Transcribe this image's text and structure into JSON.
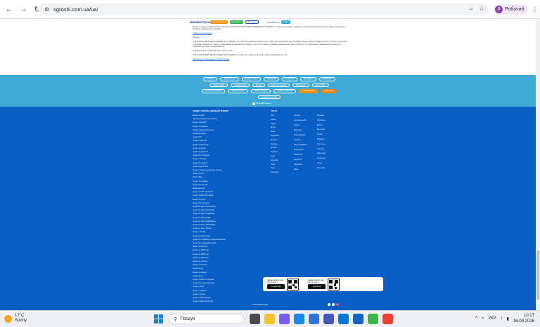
{
  "browser": {
    "url": "sgroshi.com.ua/ua/",
    "profile_label": "Робочий",
    "profile_initial": "Р"
  },
  "site_header": {
    "logo": "ШвидкоГроші",
    "buttons": [
      "Отримати кредит",
      "Продовжити",
      "Погашення"
    ],
    "phone": "0 800 806 000",
    "login": "Увійти"
  },
  "article": {
    "paragraphs": [
      "Кредити надаються фінансовою компанією ТОВ «СТРАХОВИЙ ЦЕНТР КРЕДИТНОГО СЕРВІСУ». Умови кредитування, тарифи та договори розміщено на сайті. Перед укладанням договору ознайомтесь з умовами.",
      "Правила кредитування",
      "Ліцензія: ",
      "ТОВ «СТРАХОВИЙ ЦЕНТР КРЕДИТНОГО СЕРВІСУ» м. Київ, вул. Академіка Заболотного, 148, ідентифікаційний код 37526960. Ліцензія НБУ на надання коштів у позику, в тому числі і на умовах фінансового кредиту. Інформація про фінансову установу, її послуги та умови їх надання розміщена на сайті sgroshi.com.ua. Звернення споживачів розглядаються відповідно до чинного законодавства.",
      "Інформація для споживачів щодо захисту прав.",
      "ТОВ «СТРАХОВИЙ ЦЕНТР КРЕДИТНОГО СЕРВІСУ» м. Київ, вул. Заболотного 148 e-mail: info@sgroshi.com.ua",
      "Звернення до Національного банку України"
    ]
  },
  "tags": {
    "items": [
      {
        "label": "На карту",
        "style": "plain"
      },
      {
        "label": "Кредит онлайн",
        "style": "plain"
      },
      {
        "label": "Кредит на карту",
        "style": "plain"
      },
      {
        "label": "Без відмов",
        "style": "plain"
      },
      {
        "label": "Терміново",
        "style": "plain"
      },
      {
        "label": "Без довідок",
        "style": "plain"
      },
      {
        "label": "Цілодобово",
        "style": "plain"
      },
      {
        "label": "Кредит під 0%",
        "style": "plain"
      },
      {
        "label": "Онлайн позика",
        "style": "plain"
      },
      {
        "label": "Під 1%",
        "style": "plain"
      },
      {
        "label": "Кредит без дзвінків",
        "style": "plain"
      },
      {
        "label": "Мікрокредит",
        "style": "plain"
      },
      {
        "label": "Гроші в борг",
        "style": "plain"
      },
      {
        "label": "Кредит без перевірок",
        "style": "plain"
      },
      {
        "label": "Швидкий кредит",
        "style": "plain"
      },
      {
        "label": "Кредит на картку",
        "style": "plain"
      },
      {
        "label": "Кредит до зарплати",
        "style": "plain"
      },
      {
        "label": "Позика онлайн",
        "style": "orange"
      },
      {
        "label": "Кредит 24/7",
        "style": "orange2"
      },
      {
        "label": "Кредит без застави",
        "style": "plain"
      }
    ],
    "all_tags_label": "Популярні запити"
  },
  "footer": {
    "col1_title": "КРЕДИТ ОНЛАЙН (ШВИДКИЙ КРЕДИТ)",
    "col1_links": [
      "Кредит онлайн",
      "На картку (банківську) в Україні",
      "Кредит терміново",
      "Кредит без відмови",
      "Кредит онлайн цілодобово",
      "Безпечний кредит",
      "Кредит 24/7",
      "Кредит студентам",
      "Кредит пенсіонерам",
      "Кредит на картку",
      "Кредит до зарплати",
      "Кредит без перевірок",
      "Кредит з 18 років",
      "Кредит без довідок",
      "Кредит безробітним",
      "Кредит з поганою кредитною історією",
      "Кредит під 0%",
      "Гроші в борг",
      "Кредит без дзвінків",
      "Кредит без застави",
      "Швидкий кредит",
      "Кредит онлайн на рахунок",
      "Кредит онлайн без відмов",
      "Кредит без фото",
      "Кредит без паспорта",
      "Кредит на карту Приватбанку",
      "Кредит на карту Монобанку",
      "Кредит на карту Ощадбанку",
      "Кредит на карту ПУМБ",
      "Кредит на карту Райффайзен",
      "Кредит на карту Укрсиббанку",
      "Кредит на карту А-Банку",
      "Кредит з 21 року",
      "Кредит для військових",
      "Кредит без офіційного працевлаштування",
      "Кредит без відвідування офісу",
      "Кредит на 5000 грн",
      "Кредит на 10000 грн",
      "Кредит на 20000 грн",
      "Кредит на 30000 грн",
      "Кредит на 1 місяць",
      "Кредит на 3 місяці",
      "Кредит на рік",
      "Кредит на вихідні",
      "Кредит вночі",
      "Кредит онлайн без дзвінків",
      "Кредит без кредитної історії",
      "Кредит у Києві",
      "Кредит у Харкові",
      "Кредит у Львові",
      "Кредит онлайн Україна",
      "Кредит онлайн на 30 днів"
    ],
    "col2_title": "МІСТА",
    "col2_links": [
      "Київ",
      "Харків",
      "Одеса",
      "Дніпро",
      "Львів",
      "Запоріжжя",
      "Вінниця",
      "Полтава",
      "Чернігів",
      "Черкаси",
      "Суми",
      "Житомир",
      "Рівне",
      "Луцьк",
      "Тернопіль"
    ],
    "col3_links": [
      "Ужгород",
      "Кропивницький",
      "Херсон",
      "Миколаїв",
      "Хмельницький",
      "Чернівці",
      "Івано-Франківськ",
      "Біла Церква",
      "Кременчук",
      "Кривий Ріг",
      "Маріуполь",
      "Ірпінь"
    ],
    "col4_links": [
      "Бровари",
      "Бориспіль",
      "Фастів",
      "Васильків",
      "Обухів",
      "Бердичів",
      "Коростень",
      "Нікополь",
      "Павлоград",
      "Каменське",
      "Умань",
      "Мукачево"
    ],
    "app_cards": [
      {
        "text": "Завантажуйте наш застосунок у",
        "store": "Google Play"
      },
      {
        "text": "Завантажуйте наш застосунок у",
        "store": "App Store"
      }
    ],
    "copyright": "© 2026 ШвидкоГроші"
  },
  "taskbar": {
    "temperature": "17°C",
    "weather": "Sunny",
    "search_placeholder": "Пошук",
    "language": "УКР",
    "time": "10:27",
    "date": "16.09.2026"
  }
}
